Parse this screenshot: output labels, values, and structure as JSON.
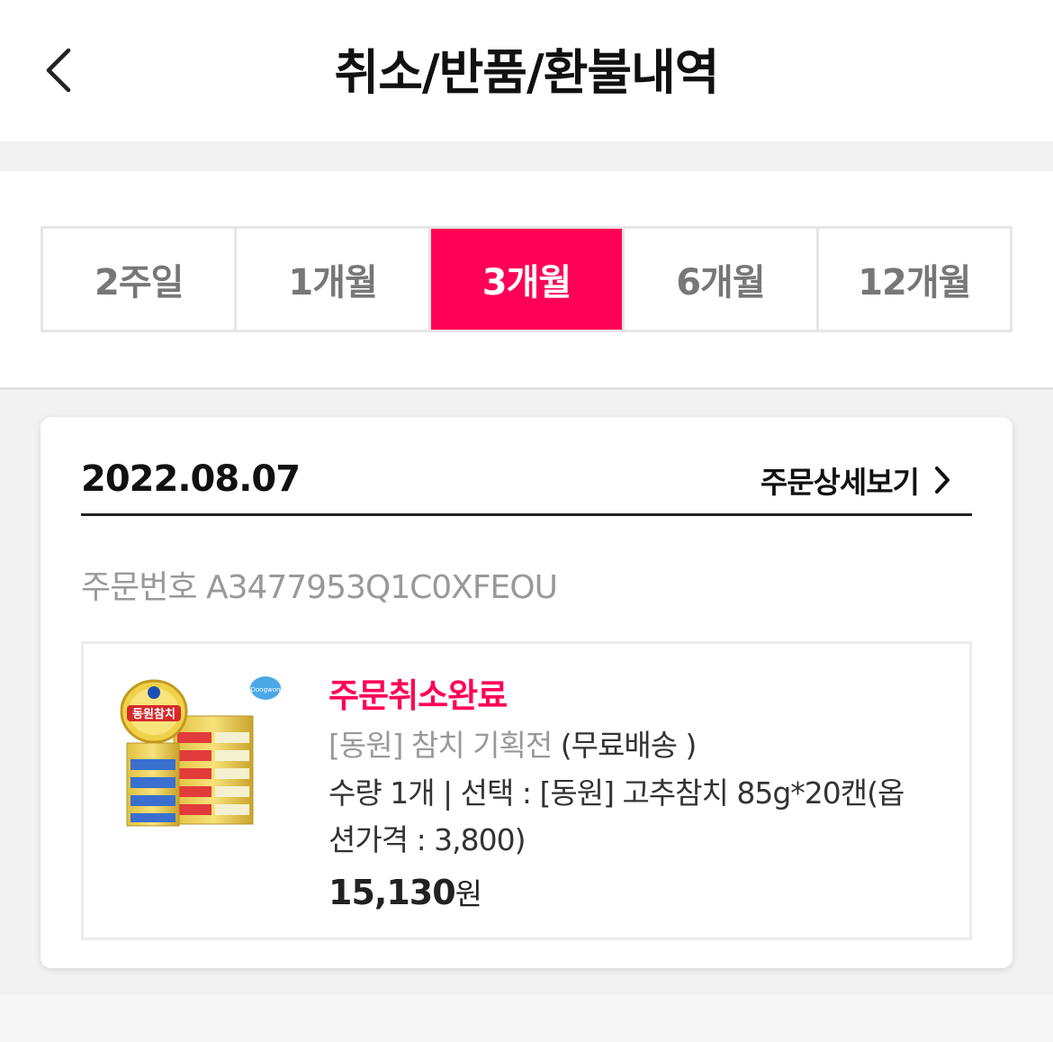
{
  "header": {
    "title": "취소/반품/환불내역",
    "back_icon": "chevron-left-icon"
  },
  "filters": {
    "tabs": [
      "2주일",
      "1개월",
      "3개월",
      "6개월",
      "12개월"
    ],
    "selected": "3개월",
    "accent_color": "#ff0156"
  },
  "order": {
    "date": "2022.08.07",
    "detail_label": "주문상세보기",
    "detail_icon": "chevron-right-icon",
    "order_number_label": "주문번호",
    "order_number": "A3477953Q1C0XFEOU",
    "item": {
      "status": "주문취소완료",
      "name": "[동원] 참치 기획전",
      "shipping": "(무료배송 )",
      "option_line1": "수량 1개  | 선택 : [동원] 고추참치 85g*20캔(옵",
      "option_line2": "션가격 : 3,800)",
      "price": "15,130",
      "currency": "원",
      "image_brand": "동원참치",
      "image_logo": "Dongwon"
    }
  }
}
